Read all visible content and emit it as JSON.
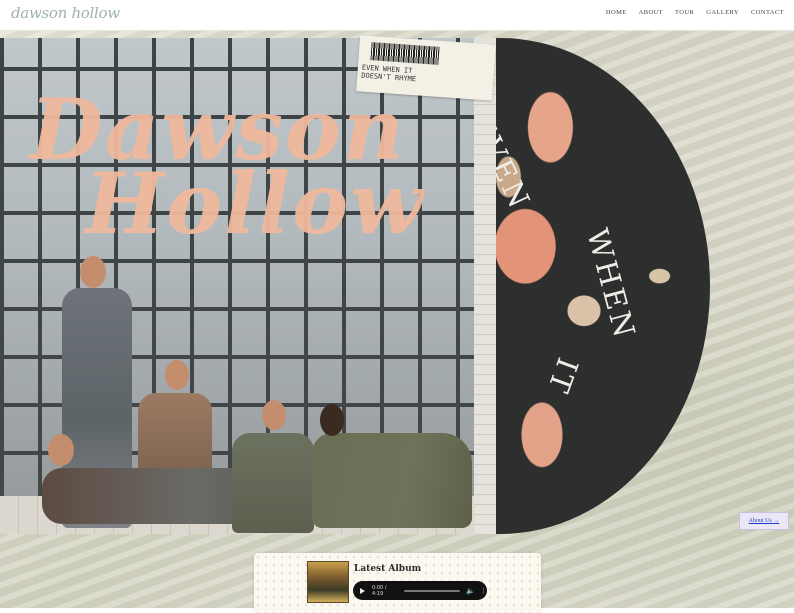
{
  "header": {
    "logo": "dawson hollow",
    "nav": [
      "HOME",
      "ABOUT",
      "TOUR",
      "GALLERY",
      "CONTACT"
    ]
  },
  "hero": {
    "band_title_line1": "Dawson",
    "band_title_line2": "Hollow",
    "vinyl_words": [
      "EVEN",
      "WHEN",
      "IT"
    ],
    "sticker_text_line1": "EVEN WHEN IT",
    "sticker_text_line2": "DOESN'T RHYME"
  },
  "about_button": "About Us →",
  "album": {
    "heading": "Latest Album",
    "time": "0:00 / 4:19"
  },
  "colors": {
    "logo": "#9cb3ad",
    "title_peach": "#efb99e",
    "vinyl_dark": "#2c2f2d"
  }
}
